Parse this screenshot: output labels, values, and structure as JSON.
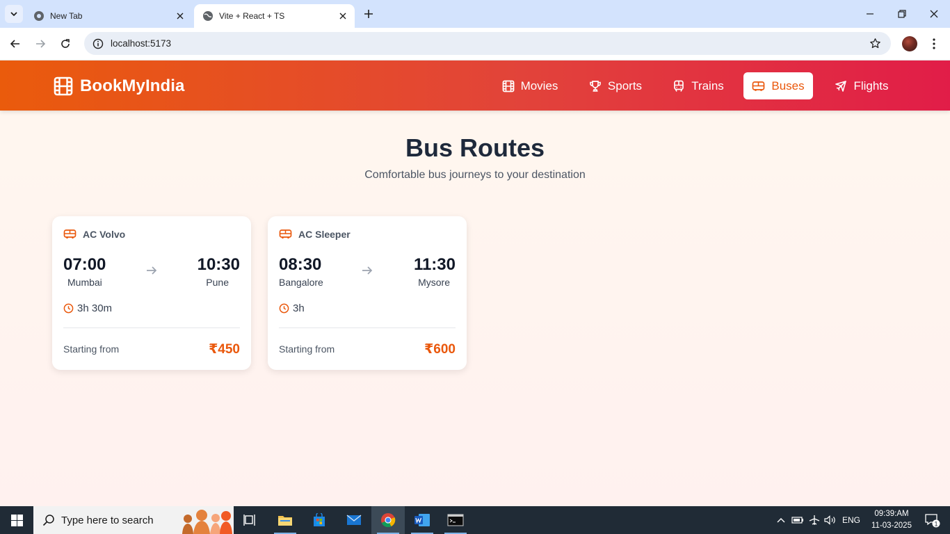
{
  "browser": {
    "tabs": [
      {
        "title": "New Tab"
      },
      {
        "title": "Vite + React + TS"
      }
    ],
    "url": "localhost:5173"
  },
  "site": {
    "brand": "BookMyIndia",
    "nav": [
      {
        "label": "Movies",
        "icon": "film-icon"
      },
      {
        "label": "Sports",
        "icon": "trophy-icon"
      },
      {
        "label": "Trains",
        "icon": "train-icon"
      },
      {
        "label": "Buses",
        "icon": "bus-icon",
        "active": true
      },
      {
        "label": "Flights",
        "icon": "plane-icon"
      }
    ],
    "heading": "Bus Routes",
    "subheading": "Comfortable bus journeys to your destination",
    "cards": [
      {
        "type": "AC Volvo",
        "depart_time": "07:00",
        "depart_city": "Mumbai",
        "arrive_time": "10:30",
        "arrive_city": "Pune",
        "duration": "3h 30m",
        "from_label": "Starting from",
        "price": "₹450"
      },
      {
        "type": "AC Sleeper",
        "depart_time": "08:30",
        "depart_city": "Bangalore",
        "arrive_time": "11:30",
        "arrive_city": "Mysore",
        "duration": "3h",
        "from_label": "Starting from",
        "price": "₹600"
      }
    ],
    "colors": {
      "accent": "#ea580c",
      "header_start": "#ea5b0c",
      "header_end": "#e11d48"
    }
  },
  "taskbar": {
    "search_placeholder": "Type here to search",
    "language": "ENG",
    "time": "09:39:AM",
    "date": "11-03-2025",
    "notification_count": "1"
  }
}
